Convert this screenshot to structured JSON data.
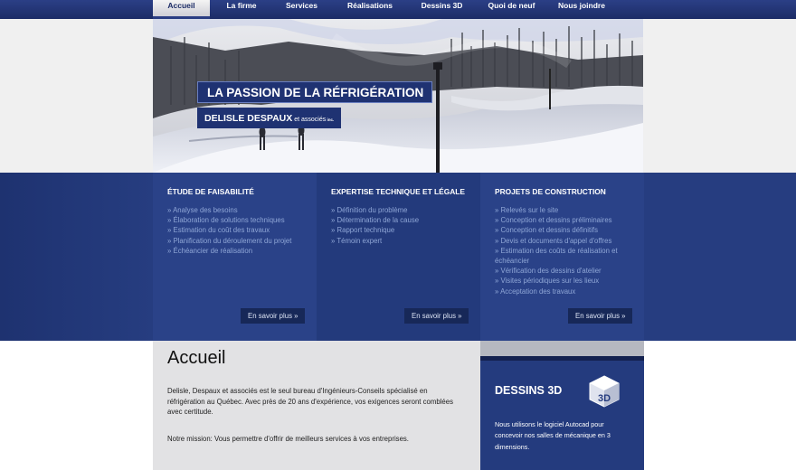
{
  "nav": {
    "items": [
      {
        "label": "Accueil",
        "active": true
      },
      {
        "label": "La firme"
      },
      {
        "label": "Services"
      },
      {
        "label": "Réalisations"
      },
      {
        "label": "Dessins 3D"
      },
      {
        "label": "Quoi de neuf"
      },
      {
        "label": "Nous joindre"
      }
    ]
  },
  "hero": {
    "title": "LA PASSION DE LA RÉFRIGÉRATION",
    "company": "DELISLE DESPAUX",
    "company_suffix": " et associés",
    "company_inc": " inc."
  },
  "services": {
    "feasibility": {
      "title": "ÉTUDE DE FAISABILITÉ",
      "items": [
        "» Analyse des besoins",
        "» Élaboration de solutions techniques",
        "» Estimation du coût des travaux",
        "» Planification du déroulement du projet",
        "» Échéancier de réalisation"
      ],
      "more": "En savoir plus »"
    },
    "expertise": {
      "title": "EXPERTISE TECHNIQUE ET LÉGALE",
      "items": [
        "» Définition du problème",
        "» Détermination de la cause",
        "» Rapport technique",
        "» Témoin expert"
      ],
      "more": "En savoir plus »"
    },
    "construction": {
      "title": "PROJETS DE CONSTRUCTION",
      "items": [
        "» Relevés sur le site",
        "» Conception et dessins préliminaires",
        "» Conception et dessins définitifs",
        "» Devis et documents d'appel d'offres",
        "» Estimation des coûts de réalisation et échéancier",
        "» Vérification des dessins d'atelier",
        "» Visites périodiques sur les lieux",
        "» Acceptation des travaux"
      ],
      "more": "En savoir plus »"
    }
  },
  "main": {
    "heading": "Accueil",
    "paragraph1": "Delisle, Despaux et associés est le seul bureau d'Ingénieurs-Conseils spécialisé en réfrigération au Québec. Avec près de 20 ans d'expérience, vos exigences seront comblées avec certitude.",
    "paragraph2": "Notre mission: Vous permettre d'offrir de meilleurs services à vos entreprises."
  },
  "sidebar": {
    "title": "DESSINS 3D",
    "text": "Nous utilisons le logiciel Autocad pour concevoir nos salles de mécanique en 3 dimensions."
  },
  "colors": {
    "nav": "#1c2c66",
    "services": "#263d80",
    "button": "#172858",
    "content_bg": "#e2e2e4",
    "link": "#8fa6d6"
  }
}
